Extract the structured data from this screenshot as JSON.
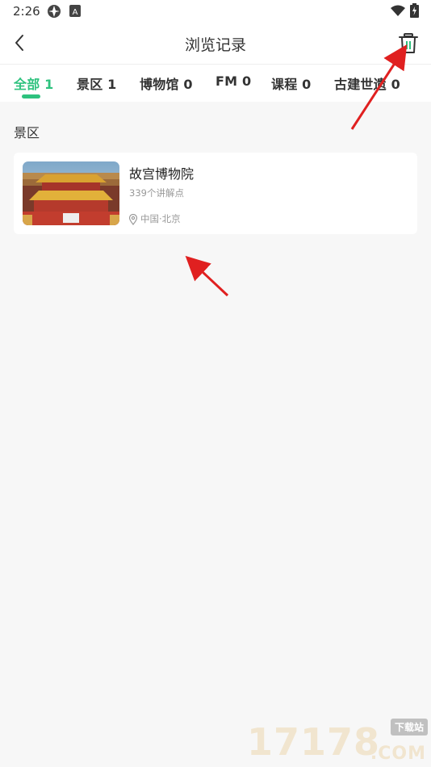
{
  "status_bar": {
    "time": "2:26",
    "icons": [
      "app-notification-icon",
      "android-icon",
      "wifi-icon",
      "battery-charging-icon"
    ]
  },
  "header": {
    "title": "浏览记录",
    "back_icon": "chevron-left-icon",
    "trash_icon": "trash-icon"
  },
  "tabs": [
    {
      "label": "全部 1",
      "active": true
    },
    {
      "label": "景区 1",
      "active": false
    },
    {
      "label": "博物馆 0",
      "active": false
    },
    {
      "label": "FM 0",
      "active": false
    },
    {
      "label": "课程 0",
      "active": false
    },
    {
      "label": "古建世遗 0",
      "active": false
    }
  ],
  "colors": {
    "accent": "#2ec27e",
    "annotation_arrow": "#e02020"
  },
  "section": {
    "label": "景区"
  },
  "history": [
    {
      "name": "故宫博物院",
      "subtitle": "339个讲解点",
      "location": "中国·北京",
      "location_icon": "location-pin-icon"
    }
  ],
  "watermark": {
    "digits": "17178",
    "badge": "下载站",
    "suffix": ".COM"
  }
}
